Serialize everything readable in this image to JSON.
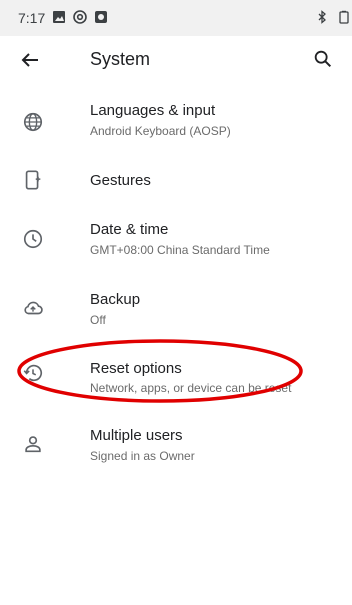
{
  "status_bar": {
    "time": "7:17",
    "icons": [
      "image-notification-icon",
      "at-notification-icon",
      "app-notification-icon",
      "bluetooth-icon",
      "battery-icon"
    ]
  },
  "app_bar": {
    "title": "System"
  },
  "items": [
    {
      "title": "Languages & input",
      "subtitle": "Android Keyboard (AOSP)",
      "icon": "globe-icon"
    },
    {
      "title": "Gestures",
      "subtitle": "",
      "icon": "gestures-icon"
    },
    {
      "title": "Date & time",
      "subtitle": "GMT+08:00 China Standard Time",
      "icon": "clock-icon"
    },
    {
      "title": "Backup",
      "subtitle": "Off",
      "icon": "cloud-upload-icon"
    },
    {
      "title": "Reset options",
      "subtitle": "Network, apps, or device can be reset",
      "icon": "restore-icon"
    },
    {
      "title": "Multiple users",
      "subtitle": "Signed in as Owner",
      "icon": "person-icon"
    }
  ],
  "colors": {
    "highlight_ring": "#e00000",
    "status_bar_bg": "#f1f1f1"
  }
}
